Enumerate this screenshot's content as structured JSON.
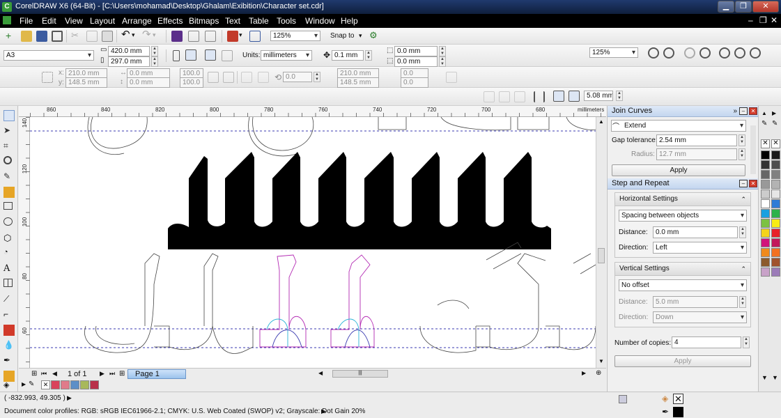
{
  "window": {
    "title": "CorelDRAW X6 (64-Bit) - [C:\\Users\\mohamad\\Desktop\\Ghalam\\Exibition\\Character set.cdr]"
  },
  "menu": [
    "File",
    "Edit",
    "View",
    "Layout",
    "Arrange",
    "Effects",
    "Bitmaps",
    "Text",
    "Table",
    "Tools",
    "Window",
    "Help"
  ],
  "standard_toolbar": {
    "zoom": "125%",
    "snap_to": "Snap to"
  },
  "property_bar": {
    "page_size": "A3",
    "width": "420.0 mm",
    "height": "297.0 mm",
    "units_label": "Units:",
    "units": "millimeters",
    "nudge": "0.1 mm",
    "dup_x": "0.0 mm",
    "dup_y": "0.0 mm",
    "zoom_right": "125%"
  },
  "transform_bar": {
    "x": "210.0 mm",
    "y": "148.5 mm",
    "w": "0.0 mm",
    "h": "0.0 mm",
    "sx": "100.0",
    "sy": "100.0",
    "angle": "0.0",
    "cx": "210.0 mm",
    "cy": "148.5 mm",
    "ox": "0.0",
    "oy": "0.0",
    "x_label": "x:",
    "y_label": "y:"
  },
  "align_bar": {
    "offset": "5.08 mm"
  },
  "ruler": {
    "h_ticks": [
      "860",
      "840",
      "820",
      "800",
      "780",
      "760",
      "740",
      "720",
      "700",
      "680"
    ],
    "v_ticks": [
      "140",
      "120",
      "100",
      "80",
      "60"
    ],
    "unit": "millimeters"
  },
  "join_curves": {
    "title": "Join Curves",
    "mode": "Extend",
    "gap_label": "Gap tolerance:",
    "gap_value": "2.54 mm",
    "radius_label": "Radius:",
    "radius_value": "12.7 mm",
    "apply": "Apply"
  },
  "step_repeat": {
    "title": "Step and Repeat",
    "horizontal_title": "Horizontal Settings",
    "h_mode": "Spacing between objects",
    "h_distance_label": "Distance:",
    "h_distance": "0.0 mm",
    "h_direction_label": "Direction:",
    "h_direction": "Left",
    "vertical_title": "Vertical Settings",
    "v_mode": "No offset",
    "v_distance_label": "Distance:",
    "v_distance": "5.0 mm",
    "v_direction_label": "Direction:",
    "v_direction": "Down",
    "copies_label": "Number of copies:",
    "copies": "4",
    "apply": "Apply"
  },
  "page_nav": {
    "count": "1 of 1",
    "page_tab": "Page 1"
  },
  "status": {
    "coords": "( -832.993, 49.305 )",
    "profiles": "Document color profiles: RGB: sRGB IEC61966-2.1; CMYK: U.S. Web Coated (SWOP) v2; Grayscale: Dot Gain 20%"
  },
  "colors": {
    "doc_palette": [
      "#d9435b",
      "#e07b8a",
      "#5d8fc7",
      "#a8b85a",
      "#b8324a"
    ],
    "palette": [
      "#000000",
      "#1a1a1a",
      "#333333",
      "#4d4d4d",
      "#666666",
      "#808080",
      "#999999",
      "#b3b3b3",
      "#cccccc",
      "#e6e6e6",
      "#ffffff",
      "#2e7bd6",
      "#1aa0e0",
      "#2db24a",
      "#7cc242",
      "#f7ec13",
      "#f4d31a",
      "#e8212a",
      "#d1127b",
      "#c2185b",
      "#f08a1c",
      "#f37021",
      "#8b5a2b",
      "#a0522d",
      "#c8a2c8",
      "#9b7bb8"
    ],
    "accent_header": "#c3d6ef"
  },
  "icons": [
    "pick-icon",
    "shape-icon",
    "crop-icon",
    "zoom-icon",
    "freehand-icon",
    "smart-fill-icon",
    "rectangle-icon",
    "ellipse-icon",
    "polygon-icon",
    "text-icon",
    "table-icon",
    "dimension-icon",
    "connector-icon",
    "blend-icon",
    "eyedropper-icon",
    "outline-icon",
    "fill-icon",
    "interactive-fill-icon"
  ]
}
